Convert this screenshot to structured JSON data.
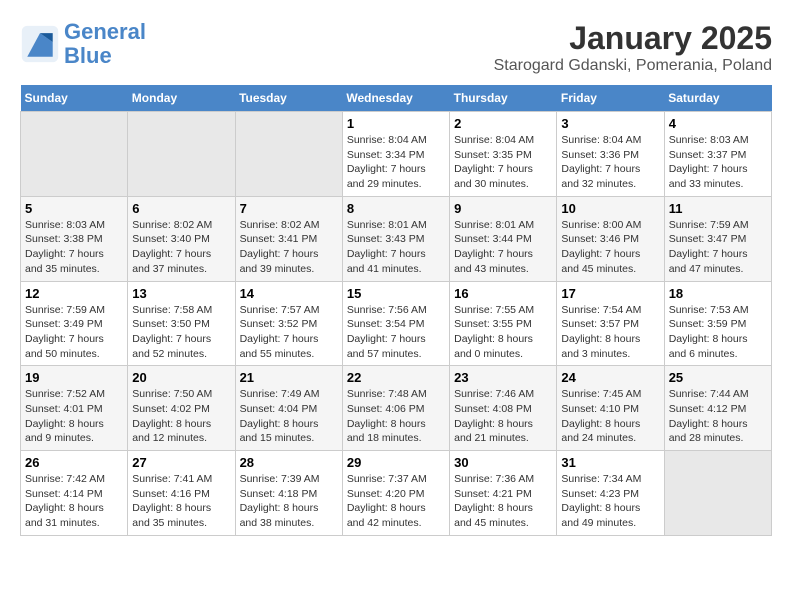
{
  "header": {
    "logo_line1": "General",
    "logo_line2": "Blue",
    "title": "January 2025",
    "subtitle": "Starogard Gdanski, Pomerania, Poland"
  },
  "days_of_week": [
    "Sunday",
    "Monday",
    "Tuesday",
    "Wednesday",
    "Thursday",
    "Friday",
    "Saturday"
  ],
  "weeks": [
    [
      {
        "num": "",
        "info": ""
      },
      {
        "num": "",
        "info": ""
      },
      {
        "num": "",
        "info": ""
      },
      {
        "num": "1",
        "info": "Sunrise: 8:04 AM\nSunset: 3:34 PM\nDaylight: 7 hours and 29 minutes."
      },
      {
        "num": "2",
        "info": "Sunrise: 8:04 AM\nSunset: 3:35 PM\nDaylight: 7 hours and 30 minutes."
      },
      {
        "num": "3",
        "info": "Sunrise: 8:04 AM\nSunset: 3:36 PM\nDaylight: 7 hours and 32 minutes."
      },
      {
        "num": "4",
        "info": "Sunrise: 8:03 AM\nSunset: 3:37 PM\nDaylight: 7 hours and 33 minutes."
      }
    ],
    [
      {
        "num": "5",
        "info": "Sunrise: 8:03 AM\nSunset: 3:38 PM\nDaylight: 7 hours and 35 minutes."
      },
      {
        "num": "6",
        "info": "Sunrise: 8:02 AM\nSunset: 3:40 PM\nDaylight: 7 hours and 37 minutes."
      },
      {
        "num": "7",
        "info": "Sunrise: 8:02 AM\nSunset: 3:41 PM\nDaylight: 7 hours and 39 minutes."
      },
      {
        "num": "8",
        "info": "Sunrise: 8:01 AM\nSunset: 3:43 PM\nDaylight: 7 hours and 41 minutes."
      },
      {
        "num": "9",
        "info": "Sunrise: 8:01 AM\nSunset: 3:44 PM\nDaylight: 7 hours and 43 minutes."
      },
      {
        "num": "10",
        "info": "Sunrise: 8:00 AM\nSunset: 3:46 PM\nDaylight: 7 hours and 45 minutes."
      },
      {
        "num": "11",
        "info": "Sunrise: 7:59 AM\nSunset: 3:47 PM\nDaylight: 7 hours and 47 minutes."
      }
    ],
    [
      {
        "num": "12",
        "info": "Sunrise: 7:59 AM\nSunset: 3:49 PM\nDaylight: 7 hours and 50 minutes."
      },
      {
        "num": "13",
        "info": "Sunrise: 7:58 AM\nSunset: 3:50 PM\nDaylight: 7 hours and 52 minutes."
      },
      {
        "num": "14",
        "info": "Sunrise: 7:57 AM\nSunset: 3:52 PM\nDaylight: 7 hours and 55 minutes."
      },
      {
        "num": "15",
        "info": "Sunrise: 7:56 AM\nSunset: 3:54 PM\nDaylight: 7 hours and 57 minutes."
      },
      {
        "num": "16",
        "info": "Sunrise: 7:55 AM\nSunset: 3:55 PM\nDaylight: 8 hours and 0 minutes."
      },
      {
        "num": "17",
        "info": "Sunrise: 7:54 AM\nSunset: 3:57 PM\nDaylight: 8 hours and 3 minutes."
      },
      {
        "num": "18",
        "info": "Sunrise: 7:53 AM\nSunset: 3:59 PM\nDaylight: 8 hours and 6 minutes."
      }
    ],
    [
      {
        "num": "19",
        "info": "Sunrise: 7:52 AM\nSunset: 4:01 PM\nDaylight: 8 hours and 9 minutes."
      },
      {
        "num": "20",
        "info": "Sunrise: 7:50 AM\nSunset: 4:02 PM\nDaylight: 8 hours and 12 minutes."
      },
      {
        "num": "21",
        "info": "Sunrise: 7:49 AM\nSunset: 4:04 PM\nDaylight: 8 hours and 15 minutes."
      },
      {
        "num": "22",
        "info": "Sunrise: 7:48 AM\nSunset: 4:06 PM\nDaylight: 8 hours and 18 minutes."
      },
      {
        "num": "23",
        "info": "Sunrise: 7:46 AM\nSunset: 4:08 PM\nDaylight: 8 hours and 21 minutes."
      },
      {
        "num": "24",
        "info": "Sunrise: 7:45 AM\nSunset: 4:10 PM\nDaylight: 8 hours and 24 minutes."
      },
      {
        "num": "25",
        "info": "Sunrise: 7:44 AM\nSunset: 4:12 PM\nDaylight: 8 hours and 28 minutes."
      }
    ],
    [
      {
        "num": "26",
        "info": "Sunrise: 7:42 AM\nSunset: 4:14 PM\nDaylight: 8 hours and 31 minutes."
      },
      {
        "num": "27",
        "info": "Sunrise: 7:41 AM\nSunset: 4:16 PM\nDaylight: 8 hours and 35 minutes."
      },
      {
        "num": "28",
        "info": "Sunrise: 7:39 AM\nSunset: 4:18 PM\nDaylight: 8 hours and 38 minutes."
      },
      {
        "num": "29",
        "info": "Sunrise: 7:37 AM\nSunset: 4:20 PM\nDaylight: 8 hours and 42 minutes."
      },
      {
        "num": "30",
        "info": "Sunrise: 7:36 AM\nSunset: 4:21 PM\nDaylight: 8 hours and 45 minutes."
      },
      {
        "num": "31",
        "info": "Sunrise: 7:34 AM\nSunset: 4:23 PM\nDaylight: 8 hours and 49 minutes."
      },
      {
        "num": "",
        "info": ""
      }
    ]
  ]
}
